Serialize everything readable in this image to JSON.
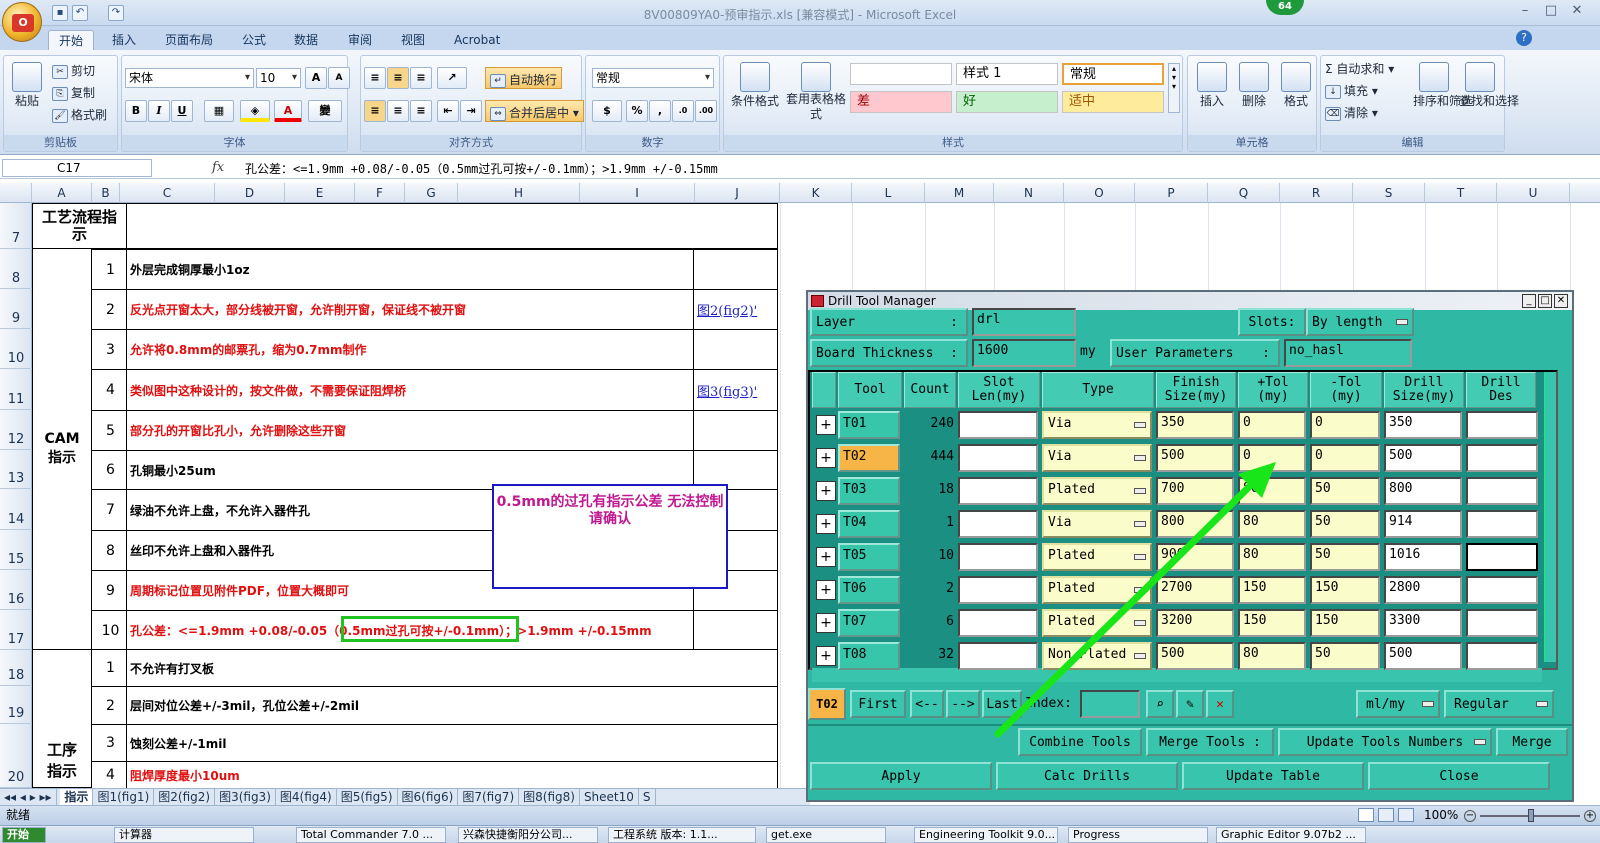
{
  "window": {
    "title": "8V00809YA0-预审指示.xls [兼容模式] - Microsoft Excel",
    "badge": "64"
  },
  "ribbon": {
    "tabs": [
      "开始",
      "插入",
      "页面布局",
      "公式",
      "数据",
      "审阅",
      "视图",
      "Acrobat"
    ],
    "clipboard": {
      "paste": "粘贴",
      "cut": "剪切",
      "copy": "复制",
      "format_painter": "格式刷",
      "label": "剪贴板"
    },
    "font": {
      "name": "宋体",
      "size": "10",
      "bold": "B",
      "italic": "I",
      "underline": "U",
      "label": "字体"
    },
    "alignment": {
      "wrap": "自动换行",
      "merge": "合并后居中",
      "label": "对齐方式"
    },
    "number": {
      "format": "常规",
      "label": "数字"
    },
    "styles": {
      "conditional": "条件格式",
      "table": "套用表格格式",
      "normal": "常规",
      "style1": "样式 1",
      "bad": "差",
      "good": "好",
      "neutral": "适中",
      "label": "样式"
    },
    "cells": {
      "insert": "插入",
      "delete": "删除",
      "format": "格式",
      "label": "单元格"
    },
    "editing": {
      "autosum": "自动求和",
      "fill": "填充",
      "clear": "清除",
      "sort": "排序和筛选",
      "find": "查找和选择",
      "label": "编辑"
    }
  },
  "formula_bar": {
    "cell_ref": "C17",
    "fx": "fx",
    "formula": "孔公差：<=1.9mm +0.08/-0.05（0.5mm过孔可按+/-0.1mm）；>1.9mm  +/-0.15mm"
  },
  "columns": [
    "A",
    "B",
    "C",
    "D",
    "E",
    "F",
    "G",
    "H",
    "I",
    "J",
    "K",
    "L",
    "M",
    "N",
    "O",
    "P",
    "Q",
    "R",
    "S",
    "T",
    "U"
  ],
  "rows": [
    "7",
    "8",
    "9",
    "10",
    "11",
    "12",
    "13",
    "14",
    "15",
    "16",
    "17",
    "18",
    "19",
    "20"
  ],
  "sheet": {
    "section_header": "工艺流程指示",
    "cam_label": "CAM指示",
    "process_label": "工序指示",
    "cam_items": [
      {
        "no": "1",
        "text": "外层完成铜厚最小1oz",
        "red": false,
        "link": ""
      },
      {
        "no": "2",
        "text": "反光点开窗太大，部分线被开窗，允许削开窗，保证线不被开窗",
        "red": true,
        "link": "图2(fig2)'"
      },
      {
        "no": "3",
        "text": "允许将0.8mm的邮票孔，缩为0.7mm制作",
        "red": true,
        "link": ""
      },
      {
        "no": "4",
        "text": "类似图中这种设计的，按文件做，不需要保证阻焊桥",
        "red": true,
        "link": "图3(fig3)'"
      },
      {
        "no": "5",
        "text": "部分孔的开窗比孔小，允许删除这些开窗",
        "red": true,
        "link": ""
      },
      {
        "no": "6",
        "text": "孔铜最小25um",
        "red": false,
        "link": ""
      },
      {
        "no": "7",
        "text": "绿油不允许上盘，不允许入器件孔",
        "red": false,
        "link": ""
      },
      {
        "no": "8",
        "text": "丝印不允许上盘和入器件孔",
        "red": false,
        "link": ""
      },
      {
        "no": "9",
        "text": "周期标记位置见附件PDF，位置大概即可",
        "red": true,
        "link": ""
      },
      {
        "no": "10",
        "text": "孔公差：<=1.9mm +0.08/-0.05（0.5mm过孔可按+/-0.1mm）；>1.9mm  +/-0.15mm",
        "red": true,
        "link": ""
      }
    ],
    "process_items": [
      {
        "no": "1",
        "text": "不允许有打叉板",
        "red": false
      },
      {
        "no": "2",
        "text": "层间对位公差+/-3mil，孔位公差+/-2mil",
        "red": false
      },
      {
        "no": "3",
        "text": "蚀刻公差+/-1mil",
        "red": false
      },
      {
        "no": "4",
        "text": "阻焊厚度最小10um",
        "red": true
      }
    ],
    "textbox": "0.5mm的过孔有指示公差  无法控制请确认"
  },
  "sheet_tabs": [
    "指示",
    "图1(fig1)",
    "图2(fig2)",
    "图3(fig3)",
    "图4(fig4)",
    "图5(fig5)",
    "图6(fig6)",
    "图7(fig7)",
    "图8(fig8)",
    "Sheet10",
    "S"
  ],
  "status": {
    "ready": "就绪",
    "zoom": "100%"
  },
  "taskbar": [
    "开始",
    "计算器",
    "Total Commander 7.0 ...",
    "兴森快捷衡阳分公司...",
    "工程系统  版本: 1.1...",
    "get.exe",
    "Engineering Toolkit 9.0...",
    "Progress",
    "Graphic Editor 9.07b2 ..."
  ],
  "dialog": {
    "title": "Drill Tool Manager",
    "layer_label": "Layer",
    "layer_value": "drl",
    "slots_label": "Slots:",
    "slots_value": "By length",
    "board_thickness_label": "Board Thickness",
    "board_thickness_value": "1600",
    "board_thickness_unit": "my",
    "user_params_label": "User Parameters",
    "user_params_value": "no_hasl",
    "headers": [
      "Tool",
      "Count",
      "Slot Len(my)",
      "Type",
      "Finish Size(my)",
      "+Tol (my)",
      "-Tol (my)",
      "Drill Size(my)",
      "Drill Des"
    ],
    "tools": [
      {
        "tool": "T01",
        "count": "240",
        "type": "Via",
        "finish": "350",
        "ptol": "0",
        "mtol": "0",
        "drill": "350"
      },
      {
        "tool": "T02",
        "count": "444",
        "type": "Via",
        "finish": "500",
        "ptol": "0",
        "mtol": "0",
        "drill": "500"
      },
      {
        "tool": "T03",
        "count": "18",
        "type": "Plated",
        "finish": "700",
        "ptol": "80",
        "mtol": "50",
        "drill": "800"
      },
      {
        "tool": "T04",
        "count": "1",
        "type": "Via",
        "finish": "800",
        "ptol": "80",
        "mtol": "50",
        "drill": "914"
      },
      {
        "tool": "T05",
        "count": "10",
        "type": "Plated",
        "finish": "900",
        "ptol": "80",
        "mtol": "50",
        "drill": "1016"
      },
      {
        "tool": "T06",
        "count": "2",
        "type": "Plated",
        "finish": "2700",
        "ptol": "150",
        "mtol": "150",
        "drill": "2800"
      },
      {
        "tool": "T07",
        "count": "6",
        "type": "Plated",
        "finish": "3200",
        "ptol": "150",
        "mtol": "150",
        "drill": "3300"
      },
      {
        "tool": "T08",
        "count": "32",
        "type": "Non Plated",
        "finish": "500",
        "ptol": "80",
        "mtol": "50",
        "drill": "500"
      }
    ],
    "selected_tool": "T02",
    "nav": {
      "first": "First",
      "prev": "<--",
      "next": "-->",
      "last": "Last",
      "index": "Index:"
    },
    "units": "ml/my",
    "mode": "Regular",
    "combine": "Combine Tools",
    "merge_tools": "Merge Tools :",
    "update_numbers": "Update Tools Numbers",
    "merge": "Merge",
    "apply": "Apply",
    "calc": "Calc Drills",
    "update_table": "Update Table",
    "close": "Close"
  }
}
